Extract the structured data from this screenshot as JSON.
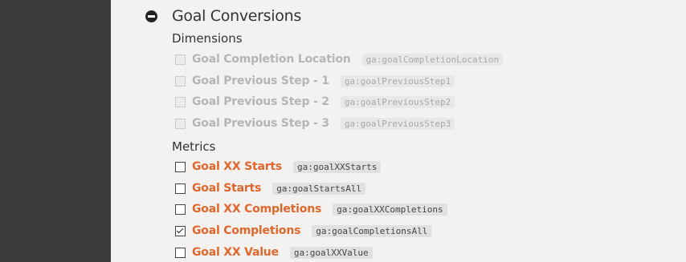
{
  "section": {
    "title": "Goal Conversions"
  },
  "dimensions": {
    "title": "Dimensions",
    "items": [
      {
        "label": "Goal Completion Location",
        "code": "ga:goalCompletionLocation"
      },
      {
        "label": "Goal Previous Step - 1",
        "code": "ga:goalPreviousStep1"
      },
      {
        "label": "Goal Previous Step - 2",
        "code": "ga:goalPreviousStep2"
      },
      {
        "label": "Goal Previous Step - 3",
        "code": "ga:goalPreviousStep3"
      }
    ]
  },
  "metrics": {
    "title": "Metrics",
    "items": [
      {
        "label": "Goal XX Starts",
        "code": "ga:goalXXStarts",
        "checked": false
      },
      {
        "label": "Goal Starts",
        "code": "ga:goalStartsAll",
        "checked": false
      },
      {
        "label": "Goal XX Completions",
        "code": "ga:goalXXCompletions",
        "checked": false
      },
      {
        "label": "Goal Completions",
        "code": "ga:goalCompletionsAll",
        "checked": true
      },
      {
        "label": "Goal XX Value",
        "code": "ga:goalXXValue",
        "checked": false
      }
    ]
  },
  "colors": {
    "accent": "#e0672c",
    "disabled": "#b5b5b5",
    "sidebar": "#3c3c3c"
  },
  "icons": {
    "collapse": "minus-circle-icon",
    "check": "checkmark-icon"
  }
}
